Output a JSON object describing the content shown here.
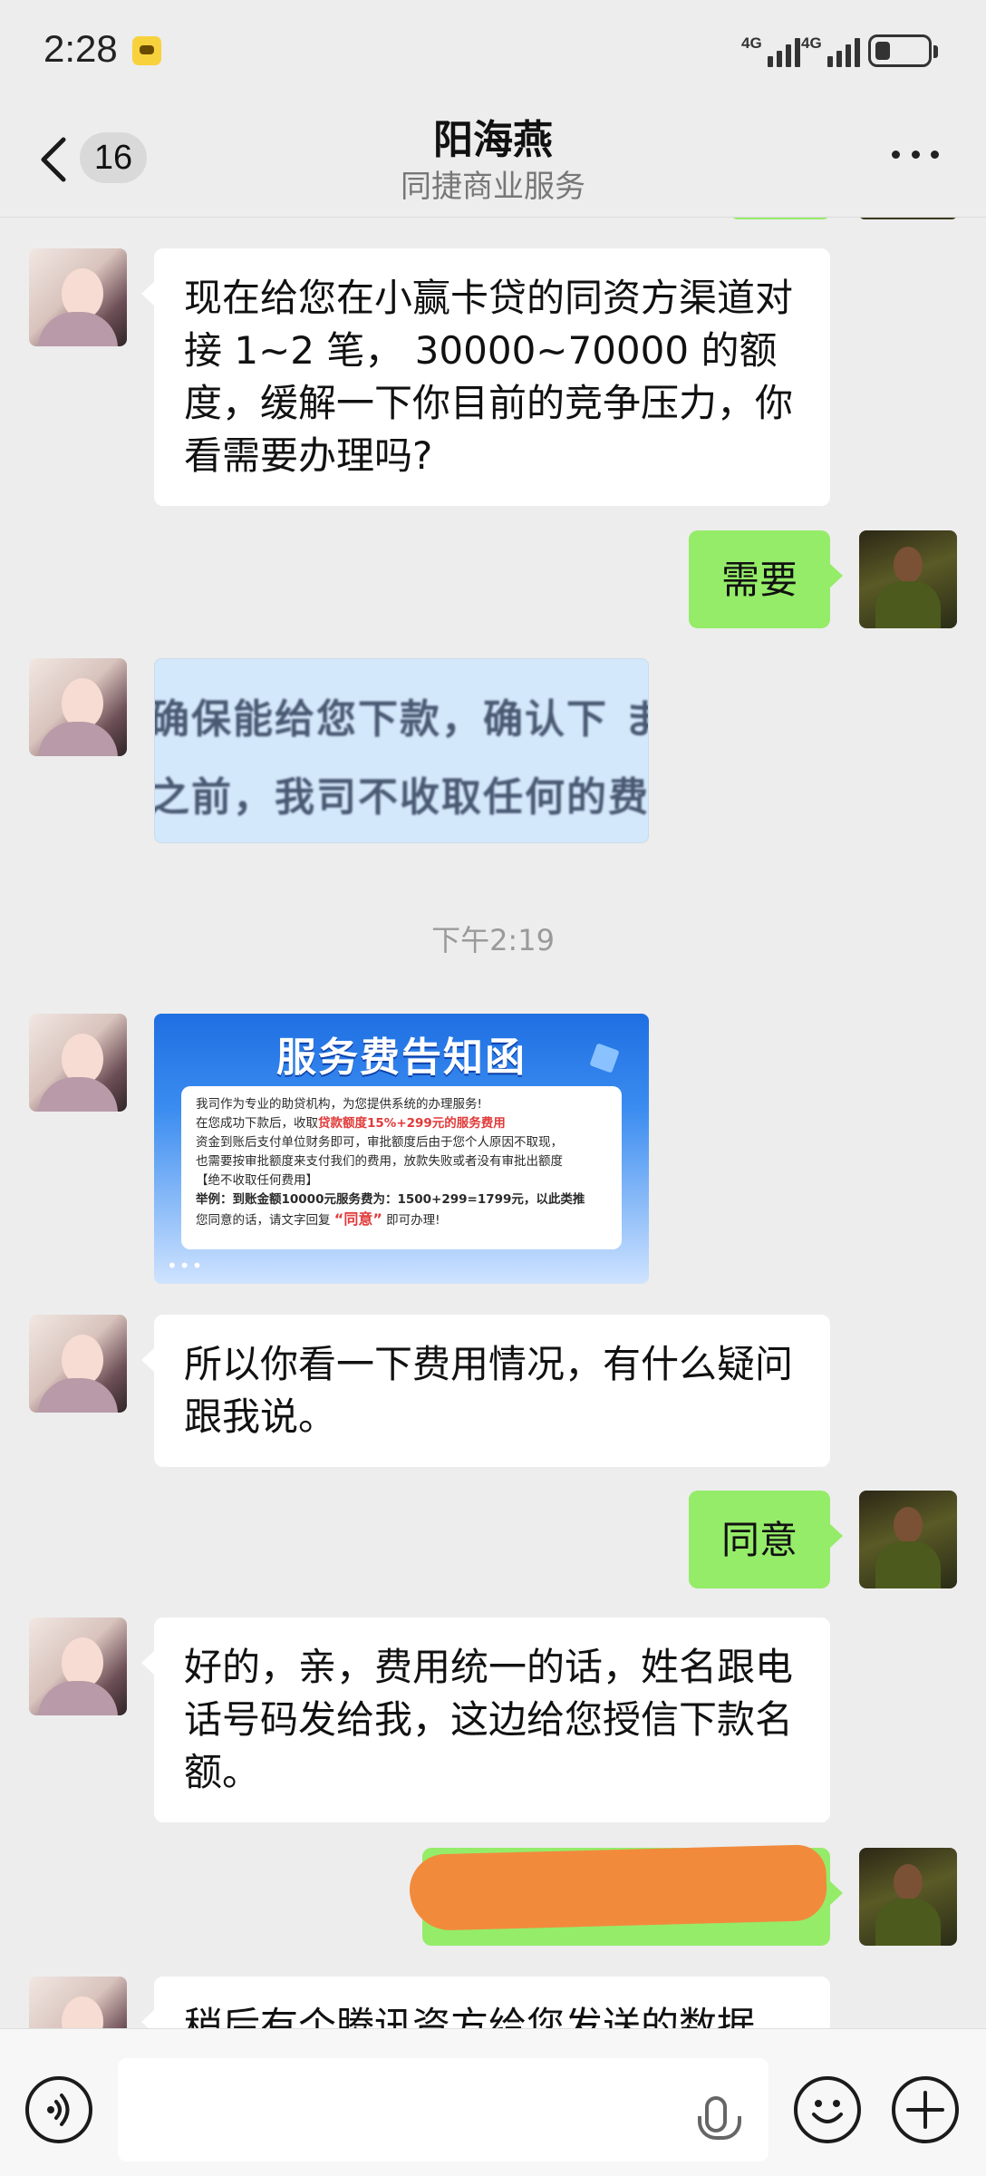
{
  "status": {
    "time": "2:28",
    "signal1_label": "4G",
    "signal2_label": "4G",
    "battery_level_percent": 30
  },
  "header": {
    "back_badge": "16",
    "title": "阳海燕",
    "subtitle": "同捷商业服务"
  },
  "messages": [
    {
      "side": "left",
      "type": "text",
      "text": "现在给您在小赢卡贷的同资方渠道对接 1~2 笔， 30000~70000 的额度，缓解一下你目前的竞争压力，你看需要办理吗?"
    },
    {
      "side": "right",
      "type": "text",
      "text": "需要"
    },
    {
      "side": "left",
      "type": "image",
      "image_lines": [
        "确保能给您下款，确认下 ま",
        "之前，我司不收取任何的费"
      ]
    },
    {
      "type": "time",
      "text": "下午2:19"
    },
    {
      "side": "left",
      "type": "image",
      "image_title": "服务费告知函",
      "image_lines": [
        "我司作为专业的助贷机构，为您提供系统的办理服务!",
        "在您成功下款后，收取",
        "贷款额度15%+299元的服务费用",
        "资金到账后支付单位财务即可，审批额度后由于您个人原因不取现，",
        "也需要按审批额度来支付我们的费用，放款失败或者没有审批出额度",
        "【绝不收取任何费用】",
        "举例：到账金额10000元服务费为：1500+299=1799元，以此类推",
        "您同意的话，请文字回复",
        "“同意”",
        "即可办理!"
      ]
    },
    {
      "side": "left",
      "type": "text",
      "text": "所以你看一下费用情况，有什么疑问跟我说。"
    },
    {
      "side": "right",
      "type": "text",
      "text": "同意"
    },
    {
      "side": "left",
      "type": "text",
      "text": "好的，亲，费用统一的话，姓名跟电话号码发给我，这边给您授信下款名额。"
    },
    {
      "side": "right",
      "type": "redacted",
      "text": ""
    },
    {
      "side": "left",
      "type": "text",
      "text": "稍后有个腾讯资方给您发送的数据"
    }
  ],
  "input": {
    "placeholder": ""
  },
  "icons": {
    "voice": "voice-mode-icon",
    "emoji": "emoji-icon",
    "plus": "plus-icon",
    "mic": "mic-icon"
  },
  "colors": {
    "background": "#ededed",
    "bubble_self": "#95ec69",
    "bubble_other": "#ffffff",
    "redaction": "#f28a3c"
  }
}
